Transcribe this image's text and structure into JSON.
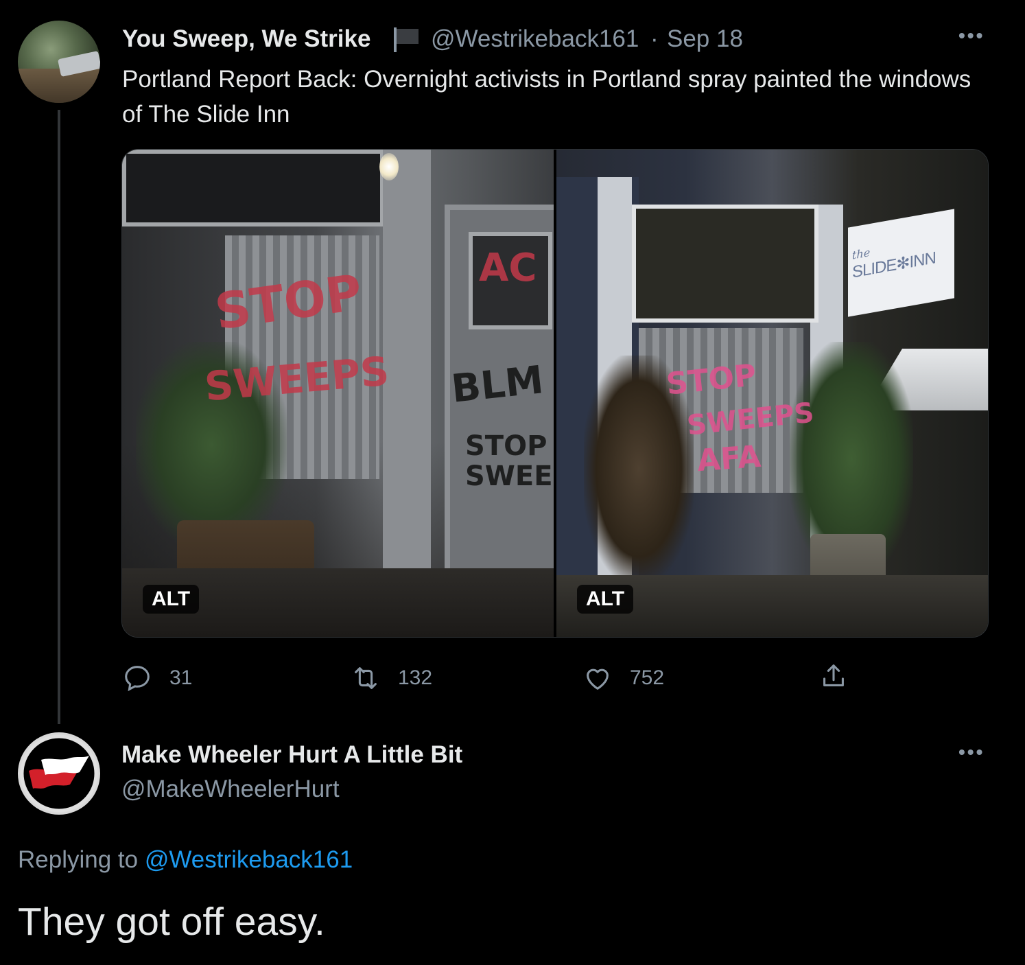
{
  "tweet1": {
    "display_name": "You Sweep, We Strike",
    "handle": "@Westrikeback161",
    "separator": "·",
    "date": "Sep 18",
    "text": "Portland Report Back: Overnight activists in Portland spray painted the windows of The Slide Inn",
    "media": {
      "alt1": "ALT",
      "alt2": "ALT",
      "photo1_graffiti": [
        "STOP",
        "SWEEPS",
        "AC",
        "BLM",
        "STOP SWEEPS"
      ],
      "photo2_graffiti": [
        "STOP",
        "SWEEPS",
        "AFA"
      ],
      "sign_text_small": "the",
      "sign_text": "SLIDE✻INN"
    },
    "actions": {
      "replies": "31",
      "retweets": "132",
      "likes": "752"
    },
    "more_label": "•••"
  },
  "tweet2": {
    "display_name": "Make Wheeler Hurt A Little Bit",
    "handle": "@MakeWheelerHurt",
    "replying_prefix": "Replying to",
    "replying_mention": "@Westrikeback161",
    "text": "They got off easy.",
    "more_label": "•••"
  },
  "colors": {
    "background": "#000000",
    "text": "#e7e9ea",
    "muted": "#8b98a5",
    "link": "#1d9bf0",
    "thread_line": "#333639",
    "antifa_red": "#d3202a"
  },
  "icons": [
    "flag-icon",
    "more-icon",
    "reply-icon",
    "retweet-icon",
    "like-icon",
    "share-icon",
    "antifa-flag-icon"
  ]
}
